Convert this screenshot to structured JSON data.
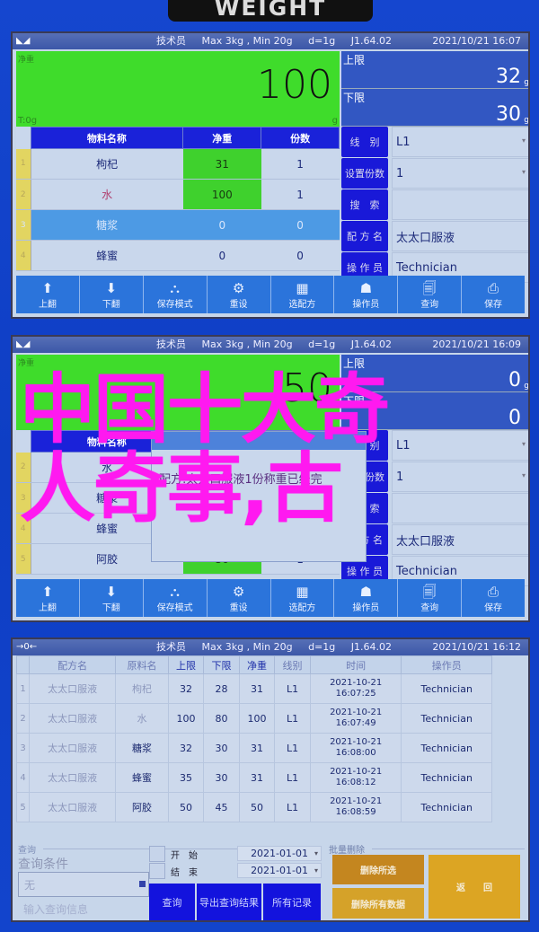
{
  "device": {
    "brand": "WEIGHT"
  },
  "status_bar": {
    "role": "技术员",
    "capacity": "Max 3kg , Min 20g",
    "division": "d=1g",
    "version": "J1.64.02"
  },
  "screen1": {
    "datetime": "2021/10/21  16:07",
    "weight_label": "净重",
    "weight_value": "100",
    "tare": "T:0g",
    "unit": "g",
    "upper_limit_label": "上限",
    "upper_limit_value": "32",
    "lower_limit_label": "下限",
    "lower_limit_value": "30",
    "limit_unit": "g",
    "table": {
      "headers": [
        "物料名称",
        "净重",
        "份数"
      ],
      "rows": [
        {
          "index": "1",
          "name": "枸杞",
          "net": "31",
          "count": "1"
        },
        {
          "index": "2",
          "name": "水",
          "net": "100",
          "count": "1"
        },
        {
          "index": "3",
          "name": "糖浆",
          "net": "0",
          "count": "0"
        },
        {
          "index": "4",
          "name": "蜂蜜",
          "net": "0",
          "count": "0"
        }
      ]
    },
    "side": {
      "line_label": "线　别",
      "line_value": "L1",
      "copies_label": "设置份数",
      "copies_value": "1",
      "search_label": "搜　索",
      "search_value": "",
      "recipe_label": "配 方 名",
      "recipe_value": "太太口服液",
      "operator_label": "操 作 员",
      "operator_value": "Technician"
    }
  },
  "toolbar": [
    {
      "icon": "arrow-up-icon",
      "glyph": "⬆",
      "label": "上翻"
    },
    {
      "icon": "arrow-down-icon",
      "glyph": "⬇",
      "label": "下翻"
    },
    {
      "icon": "stack-icon",
      "glyph": "⛬",
      "label": "保存模式"
    },
    {
      "icon": "gear-icon",
      "glyph": "⚙",
      "label": "重设"
    },
    {
      "icon": "calendar-icon",
      "glyph": "▦",
      "label": "选配方"
    },
    {
      "icon": "operator-icon",
      "glyph": "☗",
      "label": "操作员"
    },
    {
      "icon": "search-doc-icon",
      "glyph": "🗐",
      "label": "查询"
    },
    {
      "icon": "printer-icon",
      "glyph": "⎙",
      "label": "保存"
    }
  ],
  "screen2": {
    "datetime": "2021/10/21  16:09",
    "weight_value": "50",
    "upper_limit_value": "0",
    "lower_limit_value": "0",
    "dialog_message": "配方:太太口服液1份称重已经完",
    "rows": [
      {
        "index": "2",
        "name": "水"
      },
      {
        "index": "3",
        "name": "糖浆"
      },
      {
        "index": "4",
        "name": "蜂蜜"
      },
      {
        "index": "5",
        "name": "阿胶",
        "net": "50",
        "count": "1"
      }
    ],
    "side": {
      "line_value": "L1",
      "copies_value": "1",
      "recipe_value": "太太口服液",
      "operator_value": "Technician"
    }
  },
  "screen3": {
    "indicator": "→0←",
    "datetime": "2021/10/21  16:12",
    "headers": [
      "配方名",
      "原料名",
      "上限",
      "下限",
      "净重",
      "线别",
      "时间",
      "操作员"
    ],
    "records": [
      {
        "index": "1",
        "recipe": "太太口服液",
        "material": "枸杞",
        "upper": "32",
        "lower": "28",
        "net": "31",
        "line": "L1",
        "date": "2021-10-21",
        "time": "16:07:25",
        "operator": "Technician"
      },
      {
        "index": "2",
        "recipe": "太太口服液",
        "material": "水",
        "upper": "100",
        "lower": "80",
        "net": "100",
        "line": "L1",
        "date": "2021-10-21",
        "time": "16:07:49",
        "operator": "Technician"
      },
      {
        "index": "3",
        "recipe": "太太口服液",
        "material": "糖浆",
        "upper": "32",
        "lower": "30",
        "net": "31",
        "line": "L1",
        "date": "2021-10-21",
        "time": "16:08:00",
        "operator": "Technician"
      },
      {
        "index": "4",
        "recipe": "太太口服液",
        "material": "蜂蜜",
        "upper": "35",
        "lower": "30",
        "net": "31",
        "line": "L1",
        "date": "2021-10-21",
        "time": "16:08:12",
        "operator": "Technician"
      },
      {
        "index": "5",
        "recipe": "太太口服液",
        "material": "阿胶",
        "upper": "50",
        "lower": "45",
        "net": "50",
        "line": "L1",
        "date": "2021-10-21",
        "time": "16:08:59",
        "operator": "Technician"
      }
    ],
    "query": {
      "group_title": "查询",
      "condition_label": "查询条件",
      "condition_value": "无",
      "input_placeholder": "输入查询信息",
      "start_label": "开始",
      "start_value": "2021-01-01",
      "end_label": "结束",
      "end_value": "2021-01-01",
      "query_button": "查询",
      "export_button": "导出查询结果",
      "all_button": "所有记录"
    },
    "batch_delete": {
      "group_title": "批量删除",
      "delete_selected": "删除所选",
      "delete_all": "删除所有数据",
      "back": "返　　回"
    }
  },
  "caption": {
    "line1": "中国十大奇",
    "line2": "人奇事,古"
  },
  "colors": {
    "bezel": "#0f3fc9",
    "weight_ok": "#3fdc2b",
    "header_blue": "#1a22d9",
    "caption": "#ff19f0",
    "delete_orange": "#c98a21"
  }
}
